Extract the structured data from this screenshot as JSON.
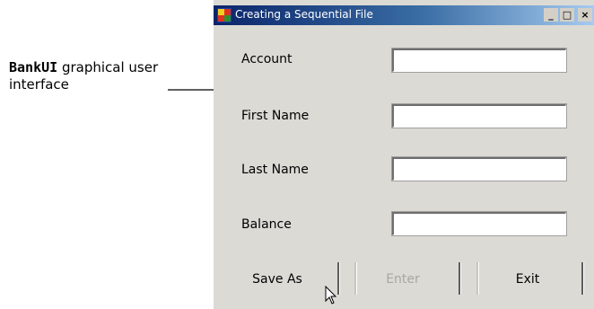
{
  "callout": {
    "code": "BankUI",
    "text_after": " graphical user interface"
  },
  "window": {
    "title": "Creating a Sequential File",
    "buttons": {
      "minimize": "_",
      "maximize": "□",
      "close": "×"
    }
  },
  "form": {
    "fields": [
      {
        "label": "Account",
        "value": ""
      },
      {
        "label": "First Name",
        "value": ""
      },
      {
        "label": "Last Name",
        "value": ""
      },
      {
        "label": "Balance",
        "value": ""
      }
    ]
  },
  "actions": {
    "save_as": "Save As",
    "enter": "Enter",
    "exit": "Exit"
  },
  "colors": {
    "window_bg": "#dcdad5",
    "titlebar_start": "#0a246a",
    "titlebar_end": "#a6caf0"
  },
  "icons": [
    "app-icon",
    "arrow-icon",
    "mouse-cursor-icon"
  ]
}
